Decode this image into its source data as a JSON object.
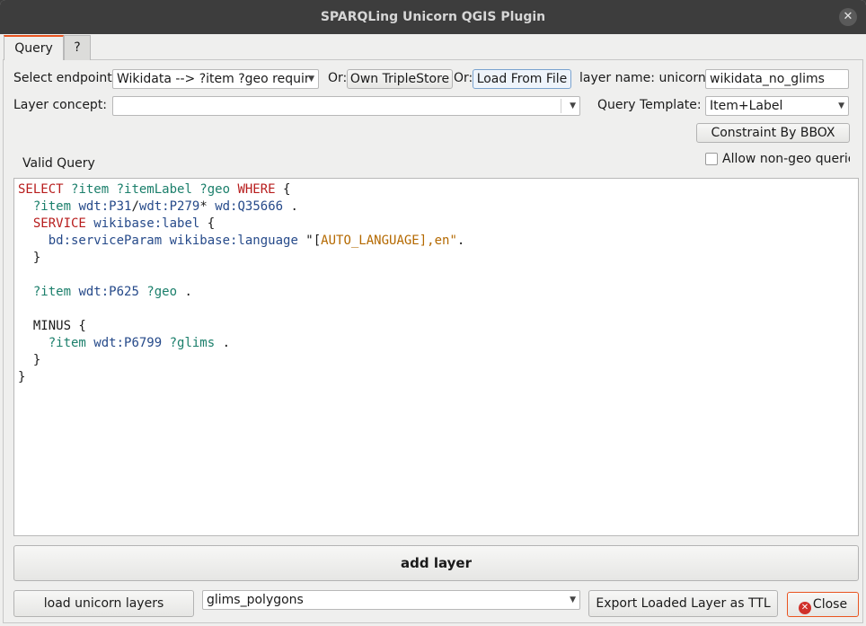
{
  "window": {
    "title": "SPARQLing Unicorn QGIS Plugin",
    "close_glyph": "✕"
  },
  "tabs": [
    {
      "label": "Query"
    },
    {
      "label": "?"
    }
  ],
  "endpoint": {
    "label": "Select endpoint:",
    "value": "Wikidata --> ?item ?geo  requir",
    "or1": "Or:",
    "own_triplestore": "Own TripleStore",
    "or2": "Or:",
    "load_from_file": "Load From File"
  },
  "layer_name": {
    "label": "layer name: unicorn_",
    "value": "wikidata_no_glims"
  },
  "layer_concept": {
    "label": "Layer concept:",
    "value": ""
  },
  "query_template": {
    "label": "Query Template:",
    "value": "Item+Label"
  },
  "constraint_bbox": {
    "label": "Constraint By BBOX"
  },
  "valid_query": {
    "label": "Valid Query"
  },
  "allow_nongeo": {
    "label": "Allow non-geo querie",
    "checked": false
  },
  "editor": {
    "lines": [
      [
        {
          "t": "SELECT ",
          "c": "kw"
        },
        {
          "t": "?item ?itemLabel ?geo ",
          "c": "var"
        },
        {
          "t": "WHERE",
          "c": "kw"
        },
        {
          "t": " {",
          "c": "plain"
        }
      ],
      [
        {
          "t": "  ?item ",
          "c": "var"
        },
        {
          "t": "wdt:P31",
          "c": "pfx"
        },
        {
          "t": "/",
          "c": "plain"
        },
        {
          "t": "wdt:P279",
          "c": "pfx"
        },
        {
          "t": "* ",
          "c": "plain"
        },
        {
          "t": "wd:Q35666",
          "c": "pfx"
        },
        {
          "t": " .",
          "c": "plain"
        }
      ],
      [
        {
          "t": "  SERVICE ",
          "c": "kw"
        },
        {
          "t": "wikibase:label",
          "c": "pfx"
        },
        {
          "t": " {",
          "c": "plain"
        }
      ],
      [
        {
          "t": "    bd:serviceParam ",
          "c": "pfx"
        },
        {
          "t": "wikibase:language ",
          "c": "pfx"
        },
        {
          "t": "\"[",
          "c": "plain"
        },
        {
          "t": "AUTO_LANGUAGE",
          "c": "str"
        },
        {
          "t": "],en\"",
          "c": "str"
        },
        {
          "t": ".",
          "c": "plain"
        }
      ],
      [
        {
          "t": "  }",
          "c": "plain"
        }
      ],
      [
        {
          "t": "",
          "c": "plain"
        }
      ],
      [
        {
          "t": "  ?item ",
          "c": "var"
        },
        {
          "t": "wdt:P625 ",
          "c": "pfx"
        },
        {
          "t": "?geo",
          "c": "var"
        },
        {
          "t": " .",
          "c": "plain"
        }
      ],
      [
        {
          "t": "",
          "c": "plain"
        }
      ],
      [
        {
          "t": "  MINUS {",
          "c": "plain"
        }
      ],
      [
        {
          "t": "    ?item ",
          "c": "var"
        },
        {
          "t": "wdt:P6799 ",
          "c": "pfx"
        },
        {
          "t": "?glims",
          "c": "var"
        },
        {
          "t": " .",
          "c": "plain"
        }
      ],
      [
        {
          "t": "  }",
          "c": "plain"
        }
      ],
      [
        {
          "t": "}",
          "c": "plain"
        }
      ]
    ]
  },
  "add_layer": {
    "label": "add layer"
  },
  "load_unicorn_layers": {
    "label": "load unicorn layers"
  },
  "layer_select": {
    "value": "glims_polygons"
  },
  "export_ttl": {
    "label": "Export Loaded Layer as TTL"
  },
  "close_button": {
    "label": "Close"
  }
}
